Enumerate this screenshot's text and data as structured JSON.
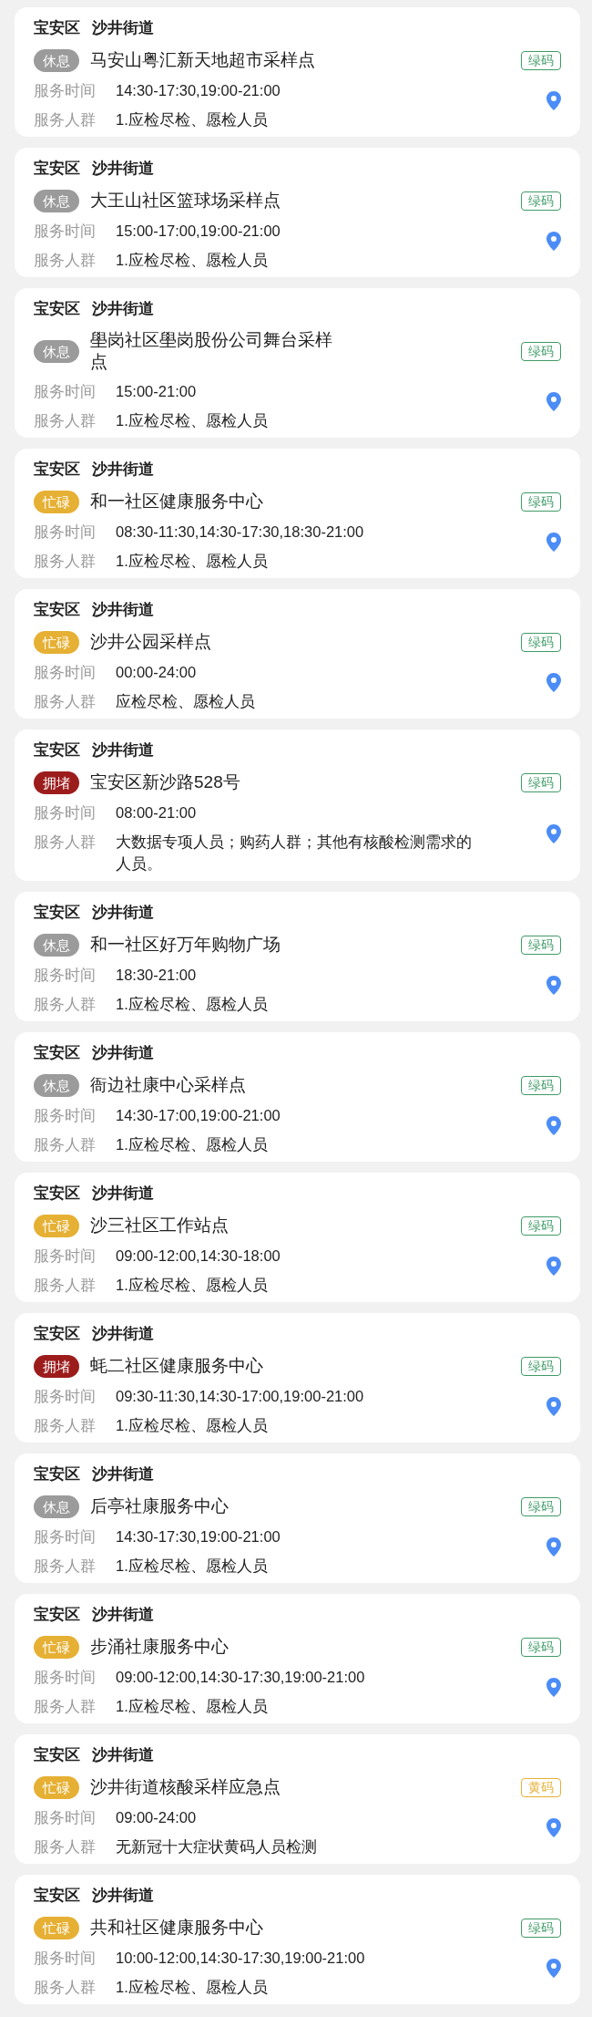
{
  "cards": [
    {
      "district": "宝安区",
      "street": "沙井街道",
      "status": {
        "label": "休息",
        "color": "#9b9b9b"
      },
      "name": "马安山粤汇新天地超市采样点",
      "code": {
        "label": "绿码",
        "color": "#3f9a66"
      },
      "time_label": "服务时间",
      "time": "14:30-17:30,19:00-21:00",
      "people_label": "服务人群",
      "people": "1.应检尽检、愿检人员"
    },
    {
      "district": "宝安区",
      "street": "沙井街道",
      "status": {
        "label": "休息",
        "color": "#9b9b9b"
      },
      "name": "大王山社区篮球场采样点",
      "code": {
        "label": "绿码",
        "color": "#3f9a66"
      },
      "time_label": "服务时间",
      "time": "15:00-17:00,19:00-21:00",
      "people_label": "服务人群",
      "people": "1.应检尽检、愿检人员"
    },
    {
      "district": "宝安区",
      "street": "沙井街道",
      "status": {
        "label": "休息",
        "color": "#9b9b9b"
      },
      "name": "壆岗社区壆岗股份公司舞台采样点",
      "code": {
        "label": "绿码",
        "color": "#3f9a66"
      },
      "time_label": "服务时间",
      "time": "15:00-21:00",
      "people_label": "服务人群",
      "people": "1.应检尽检、愿检人员"
    },
    {
      "district": "宝安区",
      "street": "沙井街道",
      "status": {
        "label": "忙碌",
        "color": "#e6b034"
      },
      "name": "和一社区健康服务中心",
      "code": {
        "label": "绿码",
        "color": "#3f9a66"
      },
      "time_label": "服务时间",
      "time": "08:30-11:30,14:30-17:30,18:30-21:00",
      "people_label": "服务人群",
      "people": "1.应检尽检、愿检人员"
    },
    {
      "district": "宝安区",
      "street": "沙井街道",
      "status": {
        "label": "忙碌",
        "color": "#e6b034"
      },
      "name": "沙井公园采样点",
      "code": {
        "label": "绿码",
        "color": "#3f9a66"
      },
      "time_label": "服务时间",
      "time": "00:00-24:00",
      "people_label": "服务人群",
      "people": "应检尽检、愿检人员"
    },
    {
      "district": "宝安区",
      "street": "沙井街道",
      "status": {
        "label": "拥堵",
        "color": "#9c1c1c"
      },
      "name": "宝安区新沙路528号",
      "code": {
        "label": "绿码",
        "color": "#3f9a66"
      },
      "time_label": "服务时间",
      "time": "08:00-21:00",
      "people_label": "服务人群",
      "people": "大数据专项人员；购药人群；其他有核酸检测需求的人员。"
    },
    {
      "district": "宝安区",
      "street": "沙井街道",
      "status": {
        "label": "休息",
        "color": "#9b9b9b"
      },
      "name": "和一社区好万年购物广场",
      "code": {
        "label": "绿码",
        "color": "#3f9a66"
      },
      "time_label": "服务时间",
      "time": "18:30-21:00",
      "people_label": "服务人群",
      "people": "1.应检尽检、愿检人员"
    },
    {
      "district": "宝安区",
      "street": "沙井街道",
      "status": {
        "label": "休息",
        "color": "#9b9b9b"
      },
      "name": "衙边社康中心采样点",
      "code": {
        "label": "绿码",
        "color": "#3f9a66"
      },
      "time_label": "服务时间",
      "time": "14:30-17:00,19:00-21:00",
      "people_label": "服务人群",
      "people": "1.应检尽检、愿检人员"
    },
    {
      "district": "宝安区",
      "street": "沙井街道",
      "status": {
        "label": "忙碌",
        "color": "#e6b034"
      },
      "name": "沙三社区工作站点",
      "code": {
        "label": "绿码",
        "color": "#3f9a66"
      },
      "time_label": "服务时间",
      "time": "09:00-12:00,14:30-18:00",
      "people_label": "服务人群",
      "people": "1.应检尽检、愿检人员"
    },
    {
      "district": "宝安区",
      "street": "沙井街道",
      "status": {
        "label": "拥堵",
        "color": "#9c1c1c"
      },
      "name": "蚝二社区健康服务中心",
      "code": {
        "label": "绿码",
        "color": "#3f9a66"
      },
      "time_label": "服务时间",
      "time": "09:30-11:30,14:30-17:00,19:00-21:00",
      "people_label": "服务人群",
      "people": "1.应检尽检、愿检人员"
    },
    {
      "district": "宝安区",
      "street": "沙井街道",
      "status": {
        "label": "休息",
        "color": "#9b9b9b"
      },
      "name": "后亭社康服务中心",
      "code": {
        "label": "绿码",
        "color": "#3f9a66"
      },
      "time_label": "服务时间",
      "time": "14:30-17:30,19:00-21:00",
      "people_label": "服务人群",
      "people": "1.应检尽检、愿检人员"
    },
    {
      "district": "宝安区",
      "street": "沙井街道",
      "status": {
        "label": "忙碌",
        "color": "#e6b034"
      },
      "name": "步涌社康服务中心",
      "code": {
        "label": "绿码",
        "color": "#3f9a66"
      },
      "time_label": "服务时间",
      "time": "09:00-12:00,14:30-17:30,19:00-21:00",
      "people_label": "服务人群",
      "people": "1.应检尽检、愿检人员"
    },
    {
      "district": "宝安区",
      "street": "沙井街道",
      "status": {
        "label": "忙碌",
        "color": "#e6b034"
      },
      "name": "沙井街道核酸采样应急点",
      "code": {
        "label": "黄码",
        "color": "#e6b034"
      },
      "time_label": "服务时间",
      "time": "09:00-24:00",
      "people_label": "服务人群",
      "people": "无新冠十大症状黄码人员检测"
    },
    {
      "district": "宝安区",
      "street": "沙井街道",
      "status": {
        "label": "忙碌",
        "color": "#e6b034"
      },
      "name": "共和社区健康服务中心",
      "code": {
        "label": "绿码",
        "color": "#3f9a66"
      },
      "time_label": "服务时间",
      "time": "10:00-12:00,14:30-17:30,19:00-21:00",
      "people_label": "服务人群",
      "people": "1.应检尽检、愿检人员"
    }
  ]
}
